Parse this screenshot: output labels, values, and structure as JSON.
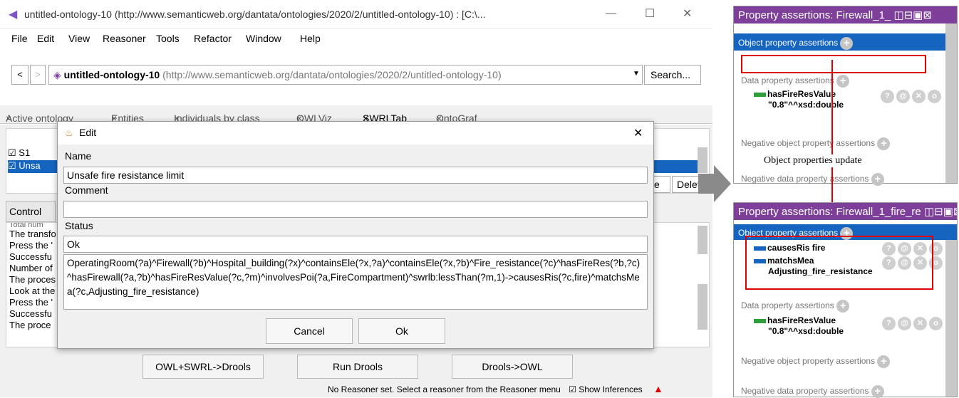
{
  "window": {
    "title": "untitled-ontology-10 (http://www.semanticweb.org/dantata/ontologies/2020/2/untitled-ontology-10)  : [C:\\...",
    "minimize": "—",
    "maximize": "☐",
    "close": "✕"
  },
  "menu": [
    "File",
    "Edit",
    "View",
    "Reasoner",
    "Tools",
    "Refactor",
    "Window",
    "Help"
  ],
  "address": {
    "back": "<",
    "forward": ">",
    "name": "untitled-ontology-10",
    "iri": "(http://www.semanticweb.org/dantata/ontologies/2020/2/untitled-ontology-10)",
    "search": "Search..."
  },
  "tabs": [
    "Active ontology",
    "Entities",
    "Individuals by class",
    "OWLViz",
    "SWRLTab",
    "OntoGraf"
  ],
  "tab_close": "×",
  "rules": [
    {
      "name": "S1"
    },
    {
      "name": "Unsa"
    }
  ],
  "side_buttons": [
    "e",
    "Delet"
  ],
  "control_tab": "Control",
  "log": [
    "Total num",
    "The transfo",
    "Press the '",
    "Successfu",
    "Number of",
    "The proces",
    "Look at the",
    "Press the '",
    "Successfu",
    "The proce"
  ],
  "bottom_buttons": [
    "OWL+SWRL->Drools",
    "Run Drools",
    "Drools->OWL"
  ],
  "status": {
    "text": "No Reasoner set. Select a reasoner from the Reasoner menu",
    "show_inferences": "Show Inferences"
  },
  "dialog": {
    "title": "Edit",
    "close": "✕",
    "name_label": "Name",
    "name_value": "Unsafe fire resistance limit",
    "comment_label": "Comment",
    "comment_value": "",
    "status_label": "Status",
    "status_value": "Ok",
    "rule": "OperatingRoom(?a)^Firewall(?b)^Hospital_building(?x)^containsEle(?x,?a)^containsEle(?x,?b)^Fire_resistance(?c)^hasFireRes(?b,?c)^hasFirewall(?a,?b)^hasFireResValue(?c,?m)^involvesPoi(?a,FireCompartment)^swrlb:lessThan(?m,1)->causesRis(?c,fire)^matchsMea(?c,Adjusting_fire_resistance)",
    "cancel": "Cancel",
    "ok": "Ok"
  },
  "panel1": {
    "title": "Property assertions: Firewall_1_",
    "obj_section": "Object property assertions",
    "data_section": "Data property assertions",
    "data_item_name": "hasFireResValue",
    "data_item_value": "\"0.8\"^^xsd:double",
    "neg_obj": "Negative object property assertions",
    "neg_data": "Negative data property assertions"
  },
  "annotation": "Object properties update",
  "panel2": {
    "title": "Property assertions: Firewall_1_fire_re",
    "obj_section": "Object property assertions",
    "obj_item1": "causesRis  fire",
    "obj_item2_a": "matchsMea",
    "obj_item2_b": "Adjusting_fire_resistance",
    "data_section": "Data property assertions",
    "data_item_name": "hasFireResValue",
    "data_item_value": "\"0.8\"^^xsd:double",
    "neg_obj": "Negative object property assertions",
    "neg_data": "Negative data property assertions"
  },
  "icon_glyphs": {
    "help": "?",
    "annotate": "@",
    "delete": "✕",
    "edit": "o"
  },
  "colors": {
    "panel_title": "#7e3f9b",
    "section_head": "#1565c0",
    "object_bar": "#1565c0",
    "data_bar": "#2e9d3a",
    "highlight": "#e00000"
  }
}
